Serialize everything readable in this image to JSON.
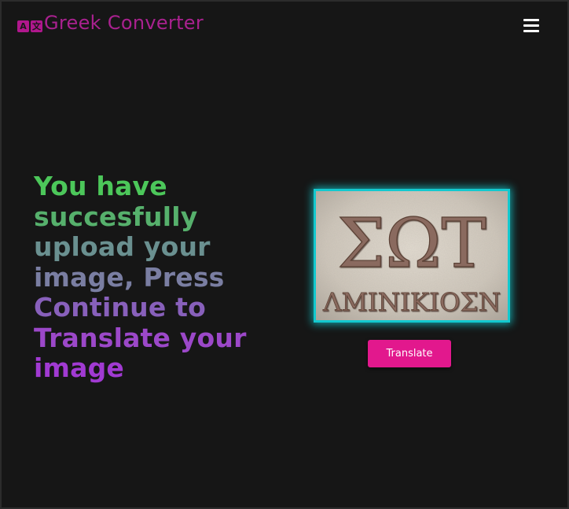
{
  "header": {
    "logo_glyphs": [
      "A",
      "文"
    ],
    "title": "Greek Converter",
    "menu_icon": "hamburger-icon"
  },
  "hero": {
    "lines": [
      "You have",
      "succesfully",
      "upload your",
      "image, Press",
      "Continue to",
      "Translate your",
      "image"
    ],
    "line_colors": [
      "#4cc75a",
      "#56b06c",
      "#6a9090",
      "#7a7ea2",
      "#8860bb",
      "#9c48c9",
      "#a13ad2"
    ]
  },
  "uploaded_image": {
    "inscription_top": "ΣΩΤ",
    "inscription_bottom": "ΛΜΙΝΙΚΙΟΣΝ"
  },
  "actions": {
    "translate_label": "Translate"
  },
  "colors": {
    "background": "#161616",
    "title": "#a9218f",
    "image_border": "#13c9cf",
    "button": "#e2188d"
  }
}
